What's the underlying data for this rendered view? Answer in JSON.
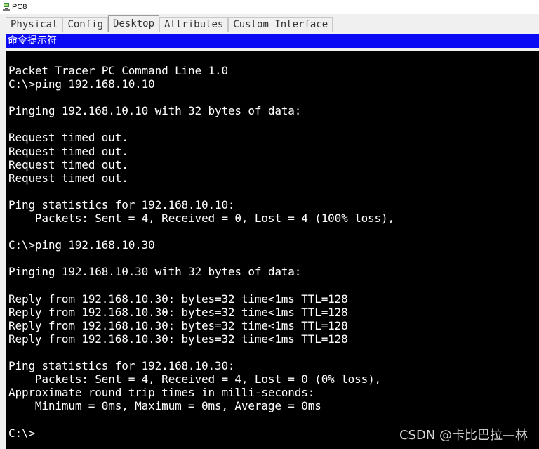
{
  "window": {
    "title": "PC8"
  },
  "tabs": [
    {
      "label": "Physical",
      "active": false
    },
    {
      "label": "Config",
      "active": false
    },
    {
      "label": "Desktop",
      "active": true
    },
    {
      "label": "Attributes",
      "active": false
    },
    {
      "label": "Custom Interface",
      "active": false
    }
  ],
  "command_prompt": {
    "header": "命令提示符",
    "output": "Packet Tracer PC Command Line 1.0\nC:\\>ping 192.168.10.10\n\nPinging 192.168.10.10 with 32 bytes of data:\n\nRequest timed out.\nRequest timed out.\nRequest timed out.\nRequest timed out.\n\nPing statistics for 192.168.10.10:\n    Packets: Sent = 4, Received = 0, Lost = 4 (100% loss),\n\nC:\\>ping 192.168.10.30\n\nPinging 192.168.10.30 with 32 bytes of data:\n\nReply from 192.168.10.30: bytes=32 time<1ms TTL=128\nReply from 192.168.10.30: bytes=32 time<1ms TTL=128\nReply from 192.168.10.30: bytes=32 time<1ms TTL=128\nReply from 192.168.10.30: bytes=32 time<1ms TTL=128\n\nPing statistics for 192.168.10.30:\n    Packets: Sent = 4, Received = 4, Lost = 0 (0% loss),\nApproximate round trip times in milli-seconds:\n    Minimum = 0ms, Maximum = 0ms, Average = 0ms\n\nC:\\>"
  },
  "watermark": "CSDN @卡比巴拉—林",
  "colors": {
    "header_bg": "#0a0af5",
    "terminal_bg": "#000000",
    "terminal_text": "#ffffff"
  },
  "icons": {
    "app": "packet-tracer-pc-icon"
  }
}
